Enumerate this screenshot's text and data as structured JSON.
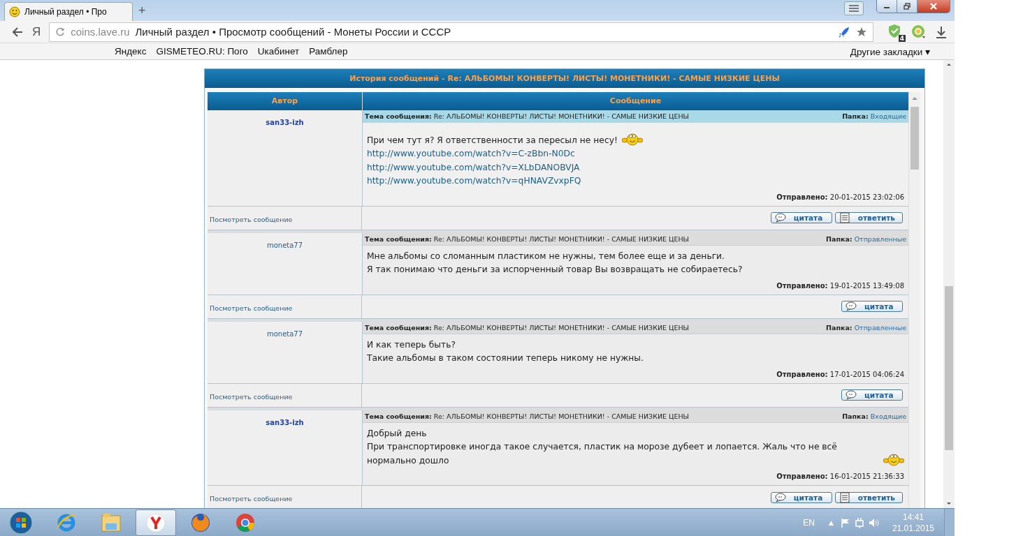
{
  "browser": {
    "tab_title": "Личный раздел • Про",
    "new_tab": "+",
    "back_letter": "Я",
    "address_host": "coins.lave.ru",
    "address_title": "Личный раздел • Просмотр сообщений - Монеты России и СССР",
    "extension_badge": "4",
    "bookmarks": [
      "Яндекс",
      "GISMETEO.RU: Пого",
      "Uкабинет",
      "Рамблер"
    ],
    "other_bookmarks": "Другие закладки ▾"
  },
  "panel": {
    "title": "История сообщений - Re: АЛЬБОМЫ! КОНВЕРТЫ! ЛИСТЫ! МОНЕТНИКИ! - САМЫЕ НИЗКИЕ ЦЕНЫ",
    "columns": [
      "Автор",
      "Сообщение"
    ]
  },
  "messages": [
    {
      "author": "san33-izh",
      "author_bold": true,
      "selected": true,
      "subject_label": "Тема сообщения:",
      "subject": "Re: АЛЬБОМЫ! КОНВЕРТЫ! ЛИСТЫ! МОНЕТНИКИ! - САМЫЕ НИЗКИЕ ЦЕНЫ",
      "folder_label": "Папка:",
      "folder": "Входящие",
      "sent_label": "Отправлено:",
      "sent": "20-01-2015 23:02:06",
      "view_link": "Посмотреть сообщение",
      "lines": [
        {
          "kind": "text",
          "text": "При чем тут я? Я ответственности за пересыл не несу!",
          "smiley": true
        },
        {
          "kind": "link",
          "text": "http://www.youtube.com/watch?v=C-zBbn-N0Dc",
          "smiley": false
        },
        {
          "kind": "link",
          "text": "http://www.youtube.com/watch?v=XLbDANOBVJA",
          "smiley": false
        },
        {
          "kind": "link",
          "text": "http://www.youtube.com/watch?v=qHNAVZvxpFQ",
          "smiley": false
        }
      ],
      "buttons": [
        {
          "kind": "quote",
          "label": "цитата"
        },
        {
          "kind": "reply",
          "label": "ответить"
        }
      ]
    },
    {
      "author": "moneta77",
      "author_bold": false,
      "selected": false,
      "subject_label": "Тема сообщения:",
      "subject": "Re: АЛЬБОМЫ! КОНВЕРТЫ! ЛИСТЫ! МОНЕТНИКИ! - САМЫЕ НИЗКИЕ ЦЕНЫ",
      "folder_label": "Папка:",
      "folder": "Отправленные",
      "sent_label": "Отправлено:",
      "sent": "19-01-2015 13:49:08",
      "view_link": "Посмотреть сообщение",
      "lines": [
        {
          "kind": "text",
          "text": "Мне альбомы со сломанным пластиком не нужны, тем более еще и за деньги.",
          "smiley": false
        },
        {
          "kind": "text",
          "text": "Я так понимаю что деньги за испорченный товар Вы возвращать не собираетесь?",
          "smiley": false
        }
      ],
      "buttons": [
        {
          "kind": "quote",
          "label": "цитата"
        }
      ]
    },
    {
      "author": "moneta77",
      "author_bold": false,
      "selected": false,
      "subject_label": "Тема сообщения:",
      "subject": "Re: АЛЬБОМЫ! КОНВЕРТЫ! ЛИСТЫ! МОНЕТНИКИ! - САМЫЕ НИЗКИЕ ЦЕНЫ",
      "folder_label": "Папка:",
      "folder": "Отправленные",
      "sent_label": "Отправлено:",
      "sent": "17-01-2015 04:06:24",
      "view_link": "Посмотреть сообщение",
      "lines": [
        {
          "kind": "text",
          "text": "И как теперь быть?",
          "smiley": false
        },
        {
          "kind": "text",
          "text": "Такие альбомы в таком состоянии теперь никому не нужны.",
          "smiley": false
        }
      ],
      "buttons": [
        {
          "kind": "quote",
          "label": "цитата"
        }
      ]
    },
    {
      "author": "san33-izh",
      "author_bold": true,
      "selected": false,
      "subject_label": "Тема сообщения:",
      "subject": "Re: АЛЬБОМЫ! КОНВЕРТЫ! ЛИСТЫ! МОНЕТНИКИ! - САМЫЕ НИЗКИЕ ЦЕНЫ",
      "folder_label": "Папка:",
      "folder": "Входящие",
      "sent_label": "Отправлено:",
      "sent": "16-01-2015 21:36:33",
      "view_link": "Посмотреть сообщение",
      "lines": [
        {
          "kind": "text",
          "text": "Добрый день",
          "smiley": false
        },
        {
          "kind": "text",
          "text": "При транспортировке иногда такое случается, пластик на морозе дубеет и лопается. Жаль что не всё нормально дошло",
          "smiley": true
        }
      ],
      "buttons": [
        {
          "kind": "quote",
          "label": "цитата"
        },
        {
          "kind": "reply",
          "label": "ответить"
        }
      ]
    }
  ],
  "taskbar": {
    "apps": [
      {
        "kind": "ie",
        "active": false
      },
      {
        "kind": "explorer",
        "active": false
      },
      {
        "kind": "yandex",
        "active": true
      },
      {
        "kind": "firefox",
        "active": false
      },
      {
        "kind": "chrome",
        "active": false
      }
    ],
    "language": "EN",
    "tray_arrow": "▲",
    "time": "14:41",
    "date": "21.01.2015"
  }
}
